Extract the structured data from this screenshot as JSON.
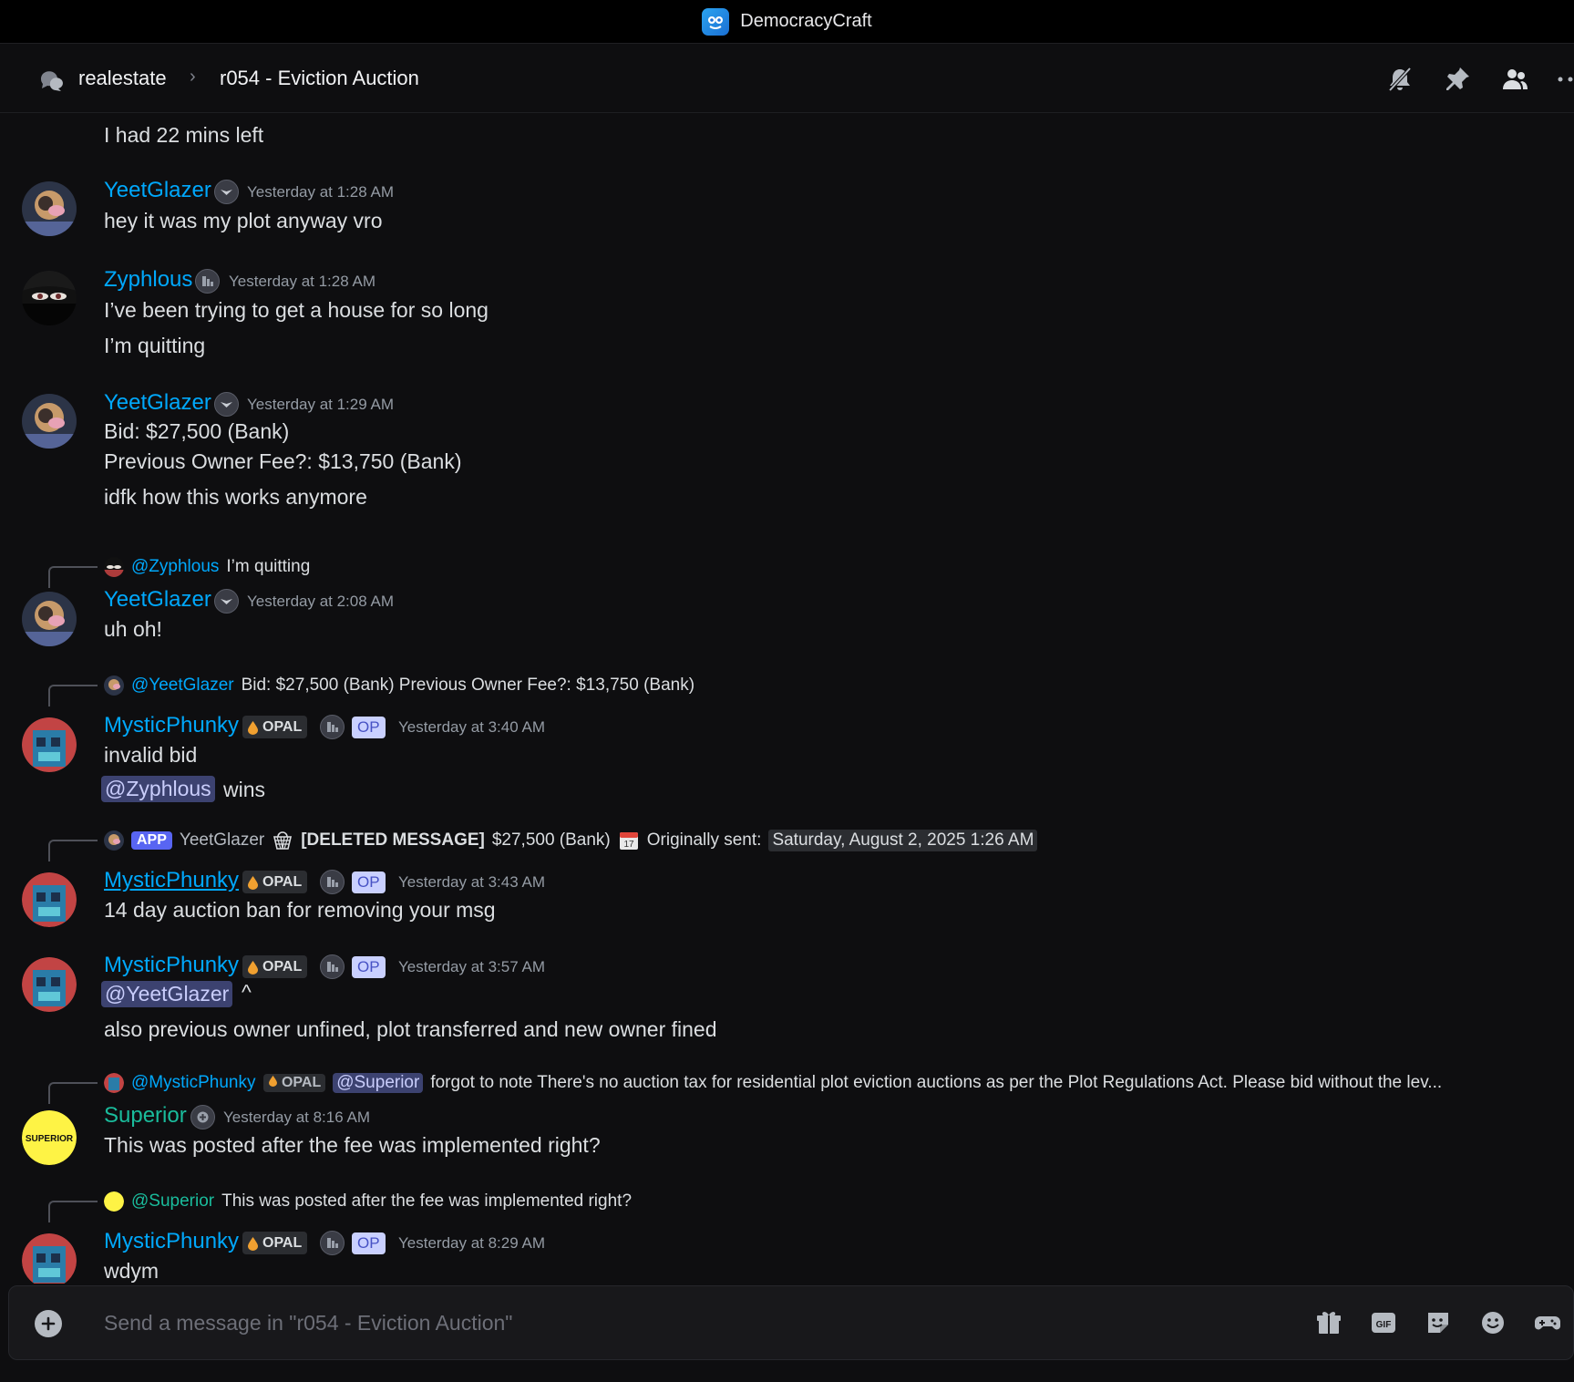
{
  "app": {
    "title": "DemocracyCraft"
  },
  "header": {
    "parent_channel": "realestate",
    "separator": "›",
    "thread_title": "r054 - Eviction Auction"
  },
  "messages": [
    {
      "text": "I had 22 mins left"
    },
    {
      "author": "YeetGlazer",
      "timestamp": "Yesterday at 1:28 AM",
      "lines": [
        "hey it was my plot anyway vro"
      ]
    },
    {
      "author": "Zyphlous",
      "timestamp": "Yesterday at 1:28 AM",
      "lines": [
        "I’ve been trying to get a house for so long",
        "I’m quitting"
      ]
    },
    {
      "author": "YeetGlazer",
      "timestamp": "Yesterday at 1:29 AM",
      "lines": [
        "Bid: $27,500 (Bank)",
        "Previous Owner Fee?: $13,750 (Bank)",
        "idfk how this works anymore"
      ]
    },
    {
      "reply_to": "@Zyphlous",
      "reply_text": "I’m quitting",
      "author": "YeetGlazer",
      "timestamp": "Yesterday at 2:08 AM",
      "lines": [
        "uh oh!"
      ]
    },
    {
      "reply_to": "@YeetGlazer",
      "reply_text": "Bid: $27,500 (Bank) Previous Owner Fee?: $13,750 (Bank)",
      "author": "MysticPhunky",
      "role_tag": "OPAL",
      "op_tag": "OP",
      "timestamp": "Yesterday at 3:40 AM",
      "lines": [
        "invalid bid"
      ],
      "mention": "@Zyphlous",
      "mention_after": "wins"
    },
    {
      "reply_app_tag": "APP",
      "reply_author": "YeetGlazer",
      "reply_deleted": "[DELETED MESSAGE]",
      "reply_amount": "$27,500 (Bank)",
      "reply_orig_label": "Originally sent:",
      "reply_date": "Saturday, August 2, 2025 1:26 AM",
      "author": "MysticPhunky",
      "role_tag": "OPAL",
      "op_tag": "OP",
      "timestamp": "Yesterday at 3:43 AM",
      "lines": [
        "14 day auction ban for removing your msg"
      ]
    },
    {
      "author": "MysticPhunky",
      "role_tag": "OPAL",
      "op_tag": "OP",
      "timestamp": "Yesterday at 3:57 AM",
      "mention": "@YeetGlazer",
      "mention_after": "^",
      "lines": [
        "also previous owner unfined, plot transferred and new owner fined"
      ]
    },
    {
      "reply_to": "@MysticPhunky",
      "reply_role": "OPAL",
      "reply_mention": "@Superior",
      "reply_text": "forgot to note There's no auction tax for residential plot eviction auctions as per the Plot Regulations Act. Please bid without the lev...",
      "author": "Superior",
      "timestamp": "Yesterday at 8:16 AM",
      "lines": [
        "This was posted after the fee was implemented right?"
      ],
      "avatar_text": "SUPERIOR"
    },
    {
      "reply_to": "@Superior",
      "reply_text": "This was posted after the fee was implemented right?",
      "author": "MysticPhunky",
      "role_tag": "OPAL",
      "op_tag": "OP",
      "timestamp": "Yesterday at 8:29 AM",
      "lines": [
        "wdym"
      ]
    }
  ],
  "composer": {
    "placeholder": "Send a message in \"r054 - Eviction Auction\""
  },
  "icons": [
    "app-logo-icon",
    "forum-icon",
    "mute-bell-icon",
    "pin-icon",
    "members-icon",
    "more-icon",
    "add-icon",
    "gift-icon",
    "gif-icon",
    "sticker-icon",
    "emoji-icon",
    "apps-icon",
    "basket-icon",
    "calendar-icon"
  ],
  "colors": {
    "background": "#0e0e10",
    "username": "#00a8fc",
    "teal_username": "#1abc9c",
    "mention_bg": "#3c4270",
    "app_tag": "#5865f2",
    "op_tag_bg": "#c9d0ff"
  }
}
